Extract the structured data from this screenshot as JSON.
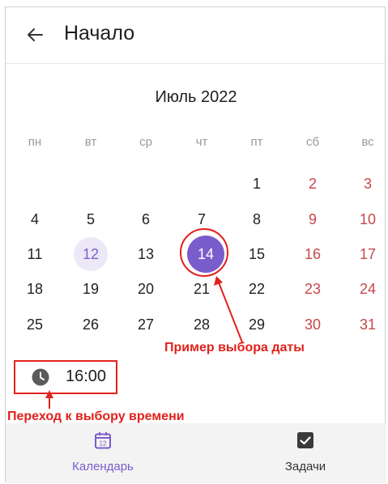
{
  "header": {
    "title": "Начало"
  },
  "calendar": {
    "month_label": "Июль 2022",
    "weekdays": [
      "пн",
      "вт",
      "ср",
      "чт",
      "пт",
      "сб",
      "вс"
    ],
    "weeks": [
      [
        "",
        "",
        "",
        "",
        "1",
        "2",
        "3"
      ],
      [
        "4",
        "5",
        "6",
        "7",
        "8",
        "9",
        "10"
      ],
      [
        "11",
        "12",
        "13",
        "14",
        "15",
        "16",
        "17"
      ],
      [
        "18",
        "19",
        "20",
        "21",
        "22",
        "23",
        "24"
      ],
      [
        "25",
        "26",
        "27",
        "28",
        "29",
        "30",
        "31"
      ]
    ],
    "today": "12",
    "selected": "14"
  },
  "time": {
    "value": "16:00"
  },
  "annotations": {
    "date_example": "Пример выбора даты",
    "time_transition": "Переход к выбору времени"
  },
  "nav": {
    "calendar_label": "Календарь",
    "calendar_icon_number": "12",
    "tasks_label": "Задачи"
  },
  "colors": {
    "accent": "#7b5ccc",
    "weekend": "#c6484a",
    "annotation": "#e0221c"
  }
}
